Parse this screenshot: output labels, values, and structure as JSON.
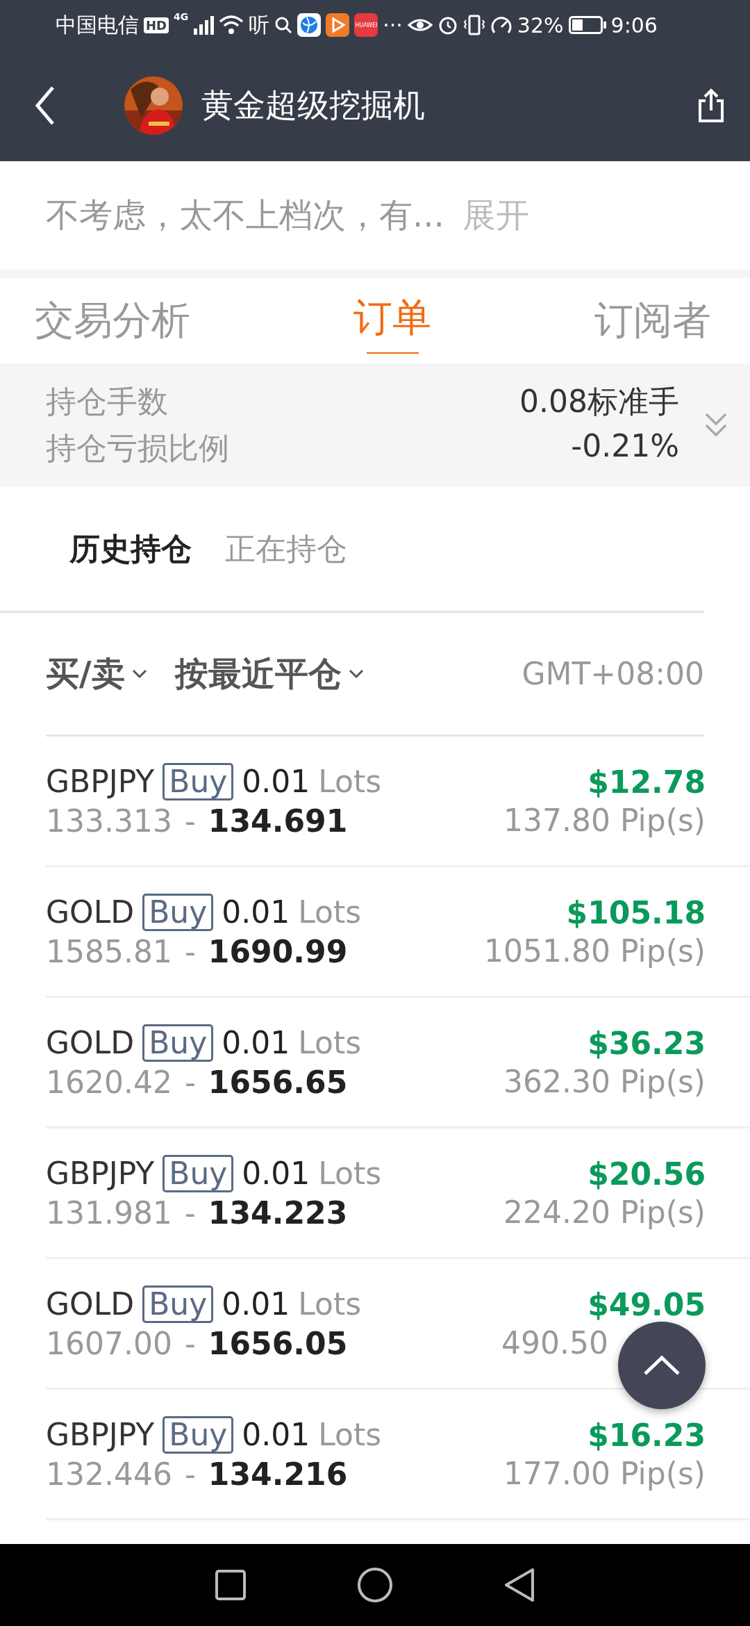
{
  "status_bar": {
    "carrier": "中国电信",
    "hd": "HD",
    "network": "4G",
    "ting": "听",
    "huawei": "HUAWEI",
    "more": "···",
    "battery_text": "32%",
    "time": "9:06"
  },
  "header": {
    "title": "黄金超级挖掘机"
  },
  "intro": {
    "text": "不考虑，太不上档次，有...",
    "expand": "展开"
  },
  "tabs": [
    {
      "label": "交易分析",
      "selected": false
    },
    {
      "label": "订单",
      "selected": true
    },
    {
      "label": "订阅者",
      "selected": false
    }
  ],
  "summary": [
    {
      "label": "持仓手数",
      "value": "0.08标准手"
    },
    {
      "label": "持仓亏损比例",
      "value": "-0.21%"
    }
  ],
  "sub_tabs": [
    {
      "label": "历史持仓",
      "selected": true
    },
    {
      "label": "正在持仓",
      "selected": false
    }
  ],
  "filters": {
    "side": "买/卖",
    "sort": "按最近平仓",
    "timezone": "GMT+08:00"
  },
  "orders": [
    {
      "symbol": "GBPJPY",
      "side": "Buy",
      "lots": "0.01",
      "unit": "Lots",
      "open": "133.313",
      "separator": "-",
      "close": "134.691",
      "profit": "$12.78",
      "pips": "137.80 Pip(s)"
    },
    {
      "symbol": "GOLD",
      "side": "Buy",
      "lots": "0.01",
      "unit": "Lots",
      "open": "1585.81",
      "separator": "-",
      "close": "1690.99",
      "profit": "$105.18",
      "pips": "1051.80 Pip(s)"
    },
    {
      "symbol": "GOLD",
      "side": "Buy",
      "lots": "0.01",
      "unit": "Lots",
      "open": "1620.42",
      "separator": "-",
      "close": "1656.65",
      "profit": "$36.23",
      "pips": "362.30 Pip(s)"
    },
    {
      "symbol": "GBPJPY",
      "side": "Buy",
      "lots": "0.01",
      "unit": "Lots",
      "open": "131.981",
      "separator": "-",
      "close": "134.223",
      "profit": "$20.56",
      "pips": "224.20 Pip(s)"
    },
    {
      "symbol": "GOLD",
      "side": "Buy",
      "lots": "0.01",
      "unit": "Lots",
      "open": "1607.00",
      "separator": "-",
      "close": "1656.05",
      "profit": "$49.05",
      "pips": "490.50",
      "covered_by_scroll_button": true
    },
    {
      "symbol": "GBPJPY",
      "side": "Buy",
      "lots": "0.01",
      "unit": "Lots",
      "open": "132.446",
      "separator": "-",
      "close": "134.216",
      "profit": "$16.23",
      "pips": "177.00 Pip(s)"
    }
  ]
}
